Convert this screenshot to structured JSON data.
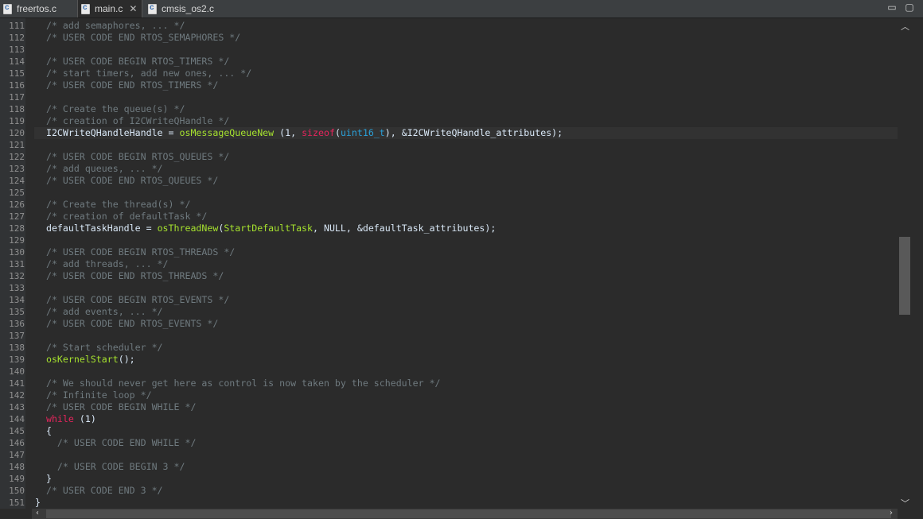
{
  "tabs": [
    {
      "label": "freertos.c",
      "active": false
    },
    {
      "label": "main.c",
      "active": true
    },
    {
      "label": "cmsis_os2.c",
      "active": false
    }
  ],
  "window_controls": {
    "minimize": "▭",
    "maximize": "▢"
  },
  "editor": {
    "lines": [
      {
        "n": "111",
        "t": "  /* add semaphores, ... */"
      },
      {
        "n": "112",
        "t": "  /* USER CODE END RTOS_SEMAPHORES */"
      },
      {
        "n": "113",
        "t": ""
      },
      {
        "n": "114",
        "t": "  /* USER CODE BEGIN RTOS_TIMERS */"
      },
      {
        "n": "115",
        "t": "  /* start timers, add new ones, ... */"
      },
      {
        "n": "116",
        "t": "  /* USER CODE END RTOS_TIMERS */"
      },
      {
        "n": "117",
        "t": ""
      },
      {
        "n": "118",
        "t": "  /* Create the queue(s) */"
      },
      {
        "n": "119",
        "t": "  /* creation of I2CWriteQHandle */"
      },
      {
        "n": "120",
        "t": "  I2CWriteQHandleHandle = osMessageQueueNew (1, sizeof(uint16_t), &I2CWriteQHandle_attributes);"
      },
      {
        "n": "121",
        "t": ""
      },
      {
        "n": "122",
        "t": "  /* USER CODE BEGIN RTOS_QUEUES */"
      },
      {
        "n": "123",
        "t": "  /* add queues, ... */"
      },
      {
        "n": "124",
        "t": "  /* USER CODE END RTOS_QUEUES */"
      },
      {
        "n": "125",
        "t": ""
      },
      {
        "n": "126",
        "t": "  /* Create the thread(s) */"
      },
      {
        "n": "127",
        "t": "  /* creation of defaultTask */"
      },
      {
        "n": "128",
        "t": "  defaultTaskHandle = osThreadNew(StartDefaultTask, NULL, &defaultTask_attributes);"
      },
      {
        "n": "129",
        "t": ""
      },
      {
        "n": "130",
        "t": "  /* USER CODE BEGIN RTOS_THREADS */"
      },
      {
        "n": "131",
        "t": "  /* add threads, ... */"
      },
      {
        "n": "132",
        "t": "  /* USER CODE END RTOS_THREADS */"
      },
      {
        "n": "133",
        "t": ""
      },
      {
        "n": "134",
        "t": "  /* USER CODE BEGIN RTOS_EVENTS */"
      },
      {
        "n": "135",
        "t": "  /* add events, ... */"
      },
      {
        "n": "136",
        "t": "  /* USER CODE END RTOS_EVENTS */"
      },
      {
        "n": "137",
        "t": ""
      },
      {
        "n": "138",
        "t": "  /* Start scheduler */"
      },
      {
        "n": "139",
        "t": "  osKernelStart();"
      },
      {
        "n": "140",
        "t": ""
      },
      {
        "n": "141",
        "t": "  /* We should never get here as control is now taken by the scheduler */"
      },
      {
        "n": "142",
        "t": "  /* Infinite loop */"
      },
      {
        "n": "143",
        "t": "  /* USER CODE BEGIN WHILE */"
      },
      {
        "n": "144",
        "t": "  while (1)"
      },
      {
        "n": "145",
        "t": "  {"
      },
      {
        "n": "146",
        "t": "    /* USER CODE END WHILE */"
      },
      {
        "n": "147",
        "t": ""
      },
      {
        "n": "148",
        "t": "    /* USER CODE BEGIN 3 */"
      },
      {
        "n": "149",
        "t": "  }"
      },
      {
        "n": "150",
        "t": "  /* USER CODE END 3 */"
      },
      {
        "n": "151",
        "t": "}"
      }
    ],
    "highlighted_line": "120"
  },
  "colors": {
    "background": "#2b2b2b",
    "comment": "#6f7a7f",
    "function": "#a6e22e",
    "keyword": "#e6245c",
    "type": "#2aa0d8"
  },
  "icons": {
    "tab_file": "c-source-file-icon",
    "tab_close": "close-icon",
    "scroll_up": "chevron-up-icon",
    "scroll_down": "chevron-down-icon",
    "scroll_left": "chevron-left-icon",
    "scroll_right": "chevron-right-icon"
  }
}
